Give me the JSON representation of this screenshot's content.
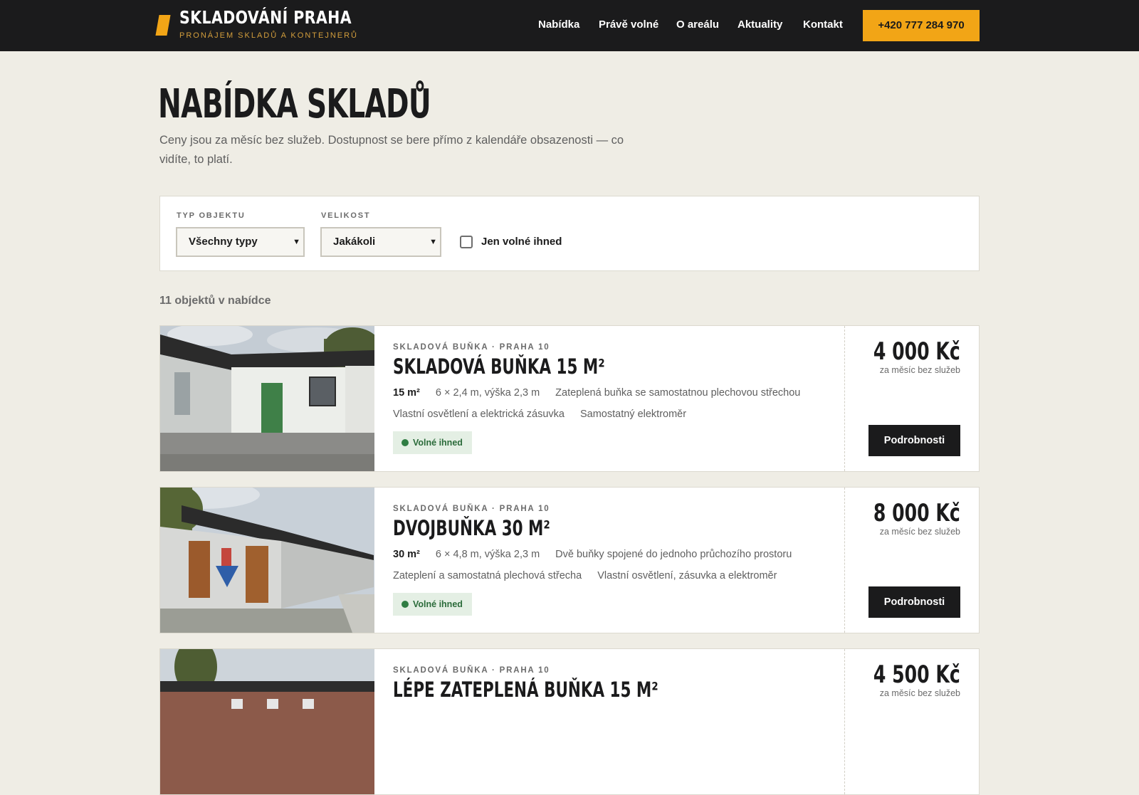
{
  "header": {
    "brand_name": "SKLADOVÁNÍ PRAHA",
    "brand_sub": "PRONÁJEM SKLADŮ A KONTEJNERŮ",
    "nav": [
      "Nabídka",
      "Právě volné",
      "O areálu",
      "Aktuality",
      "Kontakt"
    ],
    "phone": "+420 777 284 970"
  },
  "page": {
    "title": "NABÍDKA SKLADŮ",
    "intro": "Ceny jsou za měsíc bez služeb. Dostupnost se bere přímo z kalendáře obsazenosti — co vidíte, to platí."
  },
  "filters": {
    "type_label": "TYP OBJEKTU",
    "type_value": "Všechny typy",
    "size_label": "VELIKOST",
    "size_value": "Jakákoli",
    "available_only_label": "Jen volné ihned",
    "available_only_checked": false
  },
  "results": {
    "count_text": "11 objektů v nabídce"
  },
  "listings": [
    {
      "kicker": "SKLADOVÁ BUŇKA · PRAHA 10",
      "title": "SKLADOVÁ BUŇKA 15 M²",
      "area": "15 m²",
      "dims": "6 × 2,4 m, výška 2,3 m",
      "feature1": "Zateplená buňka se samostatnou plechovou střechou",
      "feature2": "Vlastní osvětlení a elektrická zásuvka",
      "feature3": "Samostatný elektroměr",
      "status": "Volné ihned",
      "price": "4 000 Kč",
      "price_note": "za měsíc bez služeb",
      "button": "Podrobnosti"
    },
    {
      "kicker": "SKLADOVÁ BUŇKA · PRAHA 10",
      "title": "DVOJBUŇKA 30 M²",
      "area": "30 m²",
      "dims": "6 × 4,8 m, výška 2,3 m",
      "feature1": "Dvě buňky spojené do jednoho průchozího prostoru",
      "feature2": "Zateplení a samostatná plechová střecha",
      "feature3": "Vlastní osvětlení, zásuvka a elektroměr",
      "status": "Volné ihned",
      "price": "8 000 Kč",
      "price_note": "za měsíc bez služeb",
      "button": "Podrobnosti"
    },
    {
      "kicker": "SKLADOVÁ BUŇKA · PRAHA 10",
      "title": "LÉPE ZATEPLENÁ BUŇKA 15 M²",
      "price": "4 500 Kč",
      "price_note": "za měsíc bez služeb"
    }
  ],
  "colors": {
    "accent": "#f2a516",
    "dark": "#1b1b1c",
    "page_bg": "#efede5",
    "status_bg": "#e4efe4",
    "status_text": "#2b6b3a"
  }
}
